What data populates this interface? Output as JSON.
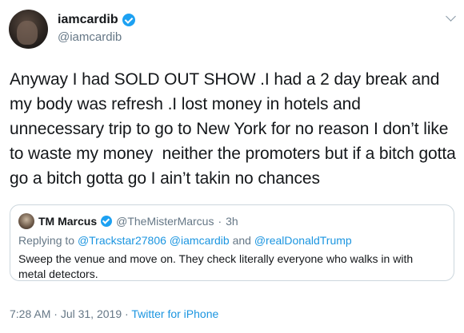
{
  "tweet": {
    "display_name": "iamcardib",
    "handle": "@iamcardib",
    "verified_icon": "verified-badge-icon",
    "text": "Anyway I had SOLD OUT SHOW .I had a 2 day break and my body was refresh .I lost money in hotels and unnecessary trip to go to New York for no reason I don’t like to waste my money  neither the promoters but if a bitch gotta go a bitch gotta go I ain’t takin no chances"
  },
  "quoted": {
    "display_name": "TM Marcus",
    "handle": "@TheMisterMarcus",
    "separator": "·",
    "time_ago": "3h",
    "replying_prefix": "Replying to ",
    "mentions": [
      "@Trackstar27806",
      "@iamcardib",
      "@realDonaldTrump"
    ],
    "and_word": "and",
    "text": "Sweep the venue and move on. They check literally everyone who walks in with metal detectors."
  },
  "footer": {
    "time": "7:28 AM",
    "date": "Jul 31, 2019",
    "separator": "·",
    "source": "Twitter for iPhone"
  },
  "colors": {
    "accent": "#1da1f2",
    "link": "#1b95e0",
    "muted": "#657786",
    "border": "#ccd6dd"
  }
}
